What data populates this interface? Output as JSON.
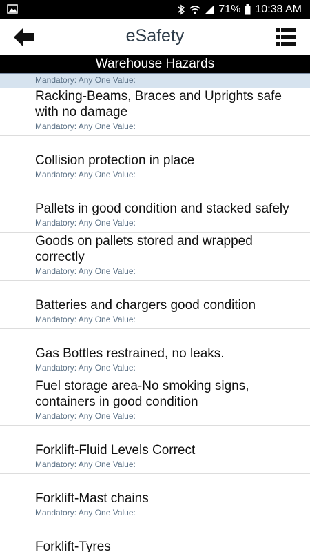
{
  "status_bar": {
    "battery": "71%",
    "time": "10:38 AM"
  },
  "header": {
    "title": "eSafety"
  },
  "section": {
    "title": "Warehouse Hazards"
  },
  "first_item_subtitle": "Mandatory: Any One Value:",
  "items": [
    {
      "title": "Racking-Beams, Braces and Uprights safe with no damage",
      "subtitle": "Mandatory: Any One Value:"
    },
    {
      "title": "Collision protection in place",
      "subtitle": "Mandatory: Any One Value:"
    },
    {
      "title": "Pallets in good condition and stacked safely",
      "subtitle": "Mandatory: Any One Value:"
    },
    {
      "title": "Goods on pallets stored and wrapped correctly",
      "subtitle": "Mandatory: Any One Value:"
    },
    {
      "title": "Batteries and chargers good condition",
      "subtitle": "Mandatory: Any One Value:"
    },
    {
      "title": "Gas Bottles restrained, no leaks.",
      "subtitle": "Mandatory: Any One Value:"
    },
    {
      "title": "Fuel storage area-No smoking signs, containers in good condition",
      "subtitle": "Mandatory: Any One Value:"
    },
    {
      "title": "Forklift-Fluid Levels Correct",
      "subtitle": "Mandatory: Any One Value:"
    },
    {
      "title": "Forklift-Mast chains",
      "subtitle": "Mandatory: Any One Value:"
    },
    {
      "title": "Forklift-Tyres",
      "subtitle": ""
    }
  ]
}
